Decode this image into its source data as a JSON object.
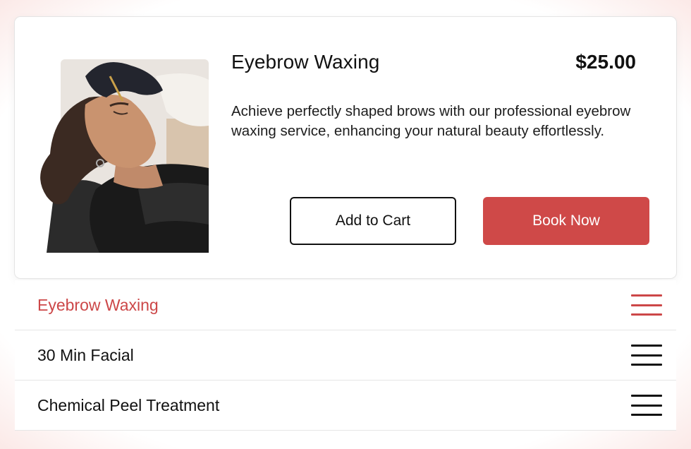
{
  "product": {
    "title": "Eyebrow Waxing",
    "price": "$25.00",
    "description": "Achieve perfectly shaped brows with our professional eyebrow waxing service, enhancing your natural beauty effortlessly.",
    "image_icon": "service-photo"
  },
  "actions": {
    "add_to_cart": "Add to Cart",
    "book_now": "Book Now"
  },
  "services": [
    {
      "label": "Eyebrow Waxing",
      "icon": "menu-icon",
      "active": true
    },
    {
      "label": "30 Min Facial",
      "icon": "menu-icon",
      "active": false
    },
    {
      "label": "Chemical Peel Treatment",
      "icon": "menu-icon",
      "active": false
    }
  ],
  "colors": {
    "accent": "#cc4748",
    "button_primary": "#cf4948",
    "text": "#111111"
  }
}
